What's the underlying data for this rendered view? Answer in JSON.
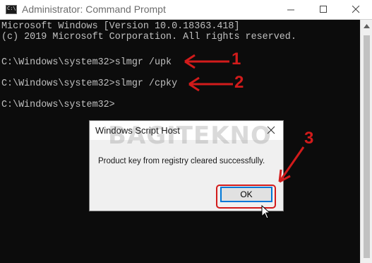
{
  "window": {
    "title": "Administrator: Command Prompt",
    "icon_label": "C:\\"
  },
  "terminal": {
    "lines": [
      "Microsoft Windows [Version 10.0.18363.418]",
      "(c) 2019 Microsoft Corporation. All rights reserved.",
      "",
      "C:\\Windows\\system32>slmgr /upk",
      "",
      "C:\\Windows\\system32>slmgr /cpky",
      "",
      "C:\\Windows\\system32>"
    ]
  },
  "dialog": {
    "title": "Windows Script Host",
    "watermark": "BAGITEKNO",
    "message": "Product key from registry cleared successfully.",
    "ok_label": "OK"
  },
  "annotations": {
    "step1": "1",
    "step2": "2",
    "step3": "3",
    "color": "#d21b1b"
  }
}
